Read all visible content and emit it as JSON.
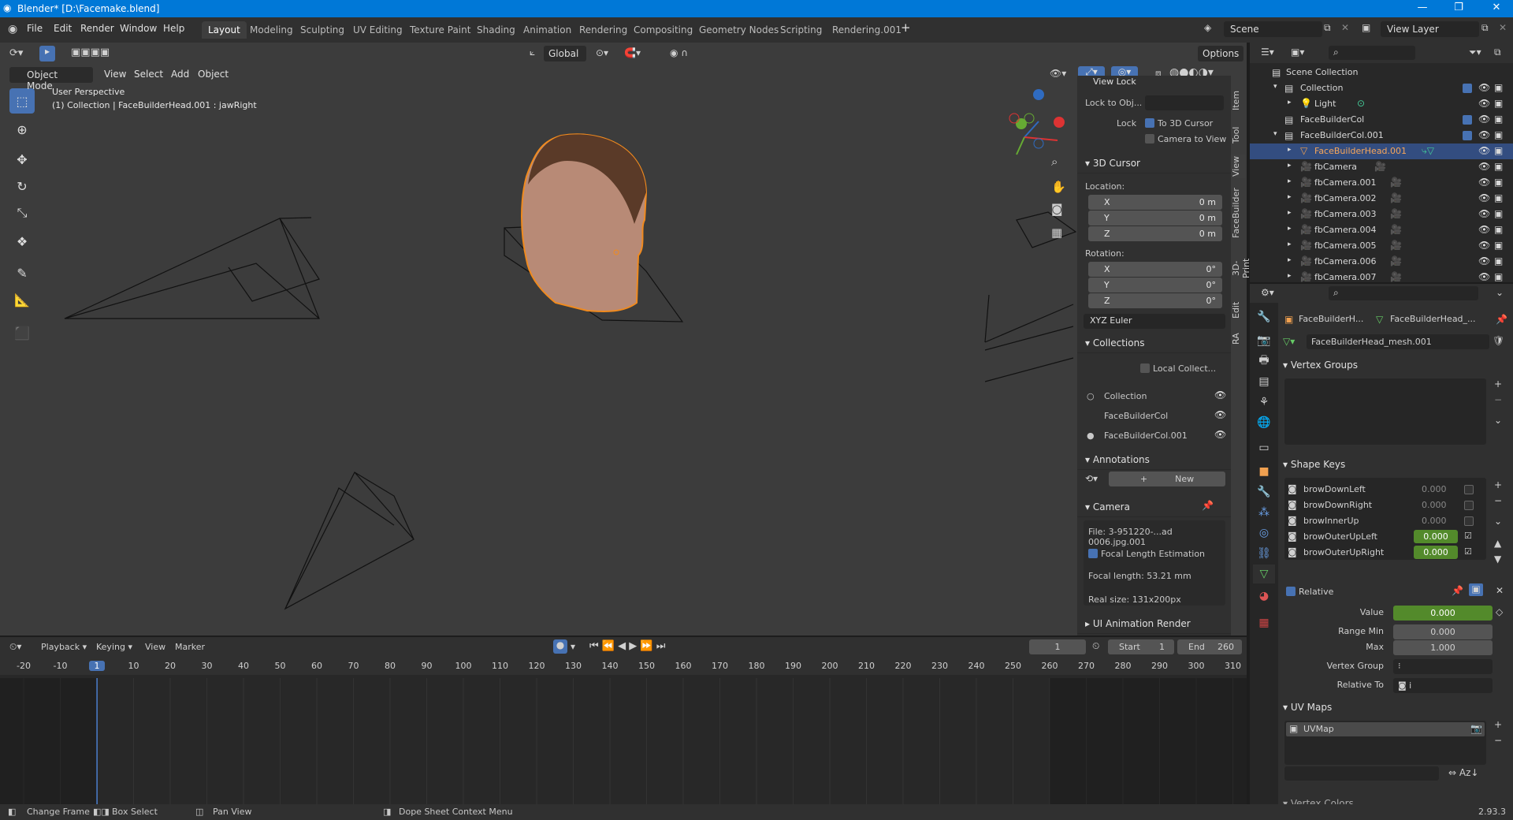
{
  "titlebar": {
    "title": "Blender* [D:\\Facemake.blend]"
  },
  "menubar": {
    "items": [
      "File",
      "Edit",
      "Render",
      "Window",
      "Help"
    ],
    "tabs": [
      "Layout",
      "Modeling",
      "Sculpting",
      "UV Editing",
      "Texture Paint",
      "Shading",
      "Animation",
      "Rendering",
      "Compositing",
      "Geometry Nodes",
      "Scripting",
      "Rendering.001"
    ],
    "scene": "Scene",
    "view_layer": "View Layer"
  },
  "viewport": {
    "mode": "Object Mode",
    "menus": [
      "View",
      "Select",
      "Add",
      "Object"
    ],
    "orientation": "Global",
    "options": "Options",
    "overlay_title": "User Perspective",
    "overlay_sub": "(1) Collection | FaceBuilderHead.001 : jawRight"
  },
  "npanel": {
    "view_lock": "View Lock",
    "lock_to_obj": "Lock to Obj...",
    "lock": "Lock",
    "to_3d_cursor": "To 3D Cursor",
    "camera_to_view": "Camera to View",
    "cursor_title": "3D Cursor",
    "location": "Location:",
    "rotation": "Rotation:",
    "loc": [
      {
        "a": "X",
        "v": "0 m"
      },
      {
        "a": "Y",
        "v": "0 m"
      },
      {
        "a": "Z",
        "v": "0 m"
      }
    ],
    "rot": [
      {
        "a": "X",
        "v": "0°"
      },
      {
        "a": "Y",
        "v": "0°"
      },
      {
        "a": "Z",
        "v": "0°"
      }
    ],
    "rot_mode": "XYZ Euler",
    "collections_title": "Collections",
    "local_collect": "Local Collect...",
    "collections": [
      "Collection",
      "FaceBuilderCol",
      "FaceBuilderCol.001"
    ],
    "annotations_title": "Annotations",
    "new": "New",
    "camera_title": "Camera",
    "file": "File: 3-951220-...ad 0006.jpg.001",
    "focal_est": "Focal Length Estimation",
    "focal_length": "Focal length: 53.21 mm",
    "real_size": "Real size: 131x200px",
    "ui_anim": "UI Animation Render",
    "tabs": [
      "Item",
      "Tool",
      "View",
      "FaceBuilder",
      "3D-Print",
      "Edit",
      "RA"
    ]
  },
  "outliner": {
    "rows": [
      {
        "indent": 0,
        "label": "Scene Collection"
      },
      {
        "indent": 1,
        "label": "Collection"
      },
      {
        "indent": 2,
        "label": "Light"
      },
      {
        "indent": 1,
        "label": "FaceBuilderCol"
      },
      {
        "indent": 1,
        "label": "FaceBuilderCol.001"
      },
      {
        "indent": 2,
        "label": "FaceBuilderHead.001"
      },
      {
        "indent": 2,
        "label": "fbCamera"
      },
      {
        "indent": 2,
        "label": "fbCamera.001"
      },
      {
        "indent": 2,
        "label": "fbCamera.002"
      },
      {
        "indent": 2,
        "label": "fbCamera.003"
      },
      {
        "indent": 2,
        "label": "fbCamera.004"
      },
      {
        "indent": 2,
        "label": "fbCamera.005"
      },
      {
        "indent": 2,
        "label": "fbCamera.006"
      },
      {
        "indent": 2,
        "label": "fbCamera.007"
      }
    ]
  },
  "props": {
    "obj": "FaceBuilderH...",
    "mesh_short": "FaceBuilderHead_...",
    "mesh": "FaceBuilderHead_mesh.001",
    "vertex_groups": "Vertex Groups",
    "shape_keys": "Shape Keys",
    "keys": [
      {
        "n": "browDownLeft",
        "v": "0.000",
        "on": false
      },
      {
        "n": "browDownRight",
        "v": "0.000",
        "on": false
      },
      {
        "n": "browInnerUp",
        "v": "0.000",
        "on": false
      },
      {
        "n": "browOuterUpLeft",
        "v": "0.000",
        "on": true
      },
      {
        "n": "browOuterUpRight",
        "v": "0.000",
        "on": true
      }
    ],
    "relative": "Relative",
    "value_l": "Value",
    "value": "0.000",
    "range_min_l": "Range Min",
    "range_min": "0.000",
    "max_l": "Max",
    "max": "1.000",
    "vertex_group_l": "Vertex Group",
    "relative_to_l": "Relative To",
    "relative_to": "i",
    "uv_maps": "UV Maps",
    "uvmap": "UVMap",
    "vertex_colors": "Vertex Colors"
  },
  "timeline": {
    "menus": [
      "Playback",
      "Keying",
      "View",
      "Marker"
    ],
    "frame": "1",
    "start_l": "Start",
    "start": "1",
    "end_l": "End",
    "end": "260",
    "ticks": [
      "-20",
      "-10",
      "1",
      "10",
      "20",
      "30",
      "40",
      "50",
      "60",
      "70",
      "80",
      "90",
      "100",
      "110",
      "120",
      "130",
      "140",
      "150",
      "160",
      "170",
      "180",
      "190",
      "200",
      "210",
      "220",
      "230",
      "240",
      "250",
      "260",
      "270",
      "280",
      "290",
      "300",
      "310"
    ]
  },
  "status": {
    "change_frame": "Change Frame",
    "box_select": "Box Select",
    "pan_view": "Pan View",
    "context": "Dope Sheet Context Menu",
    "version": "2.93.3"
  }
}
